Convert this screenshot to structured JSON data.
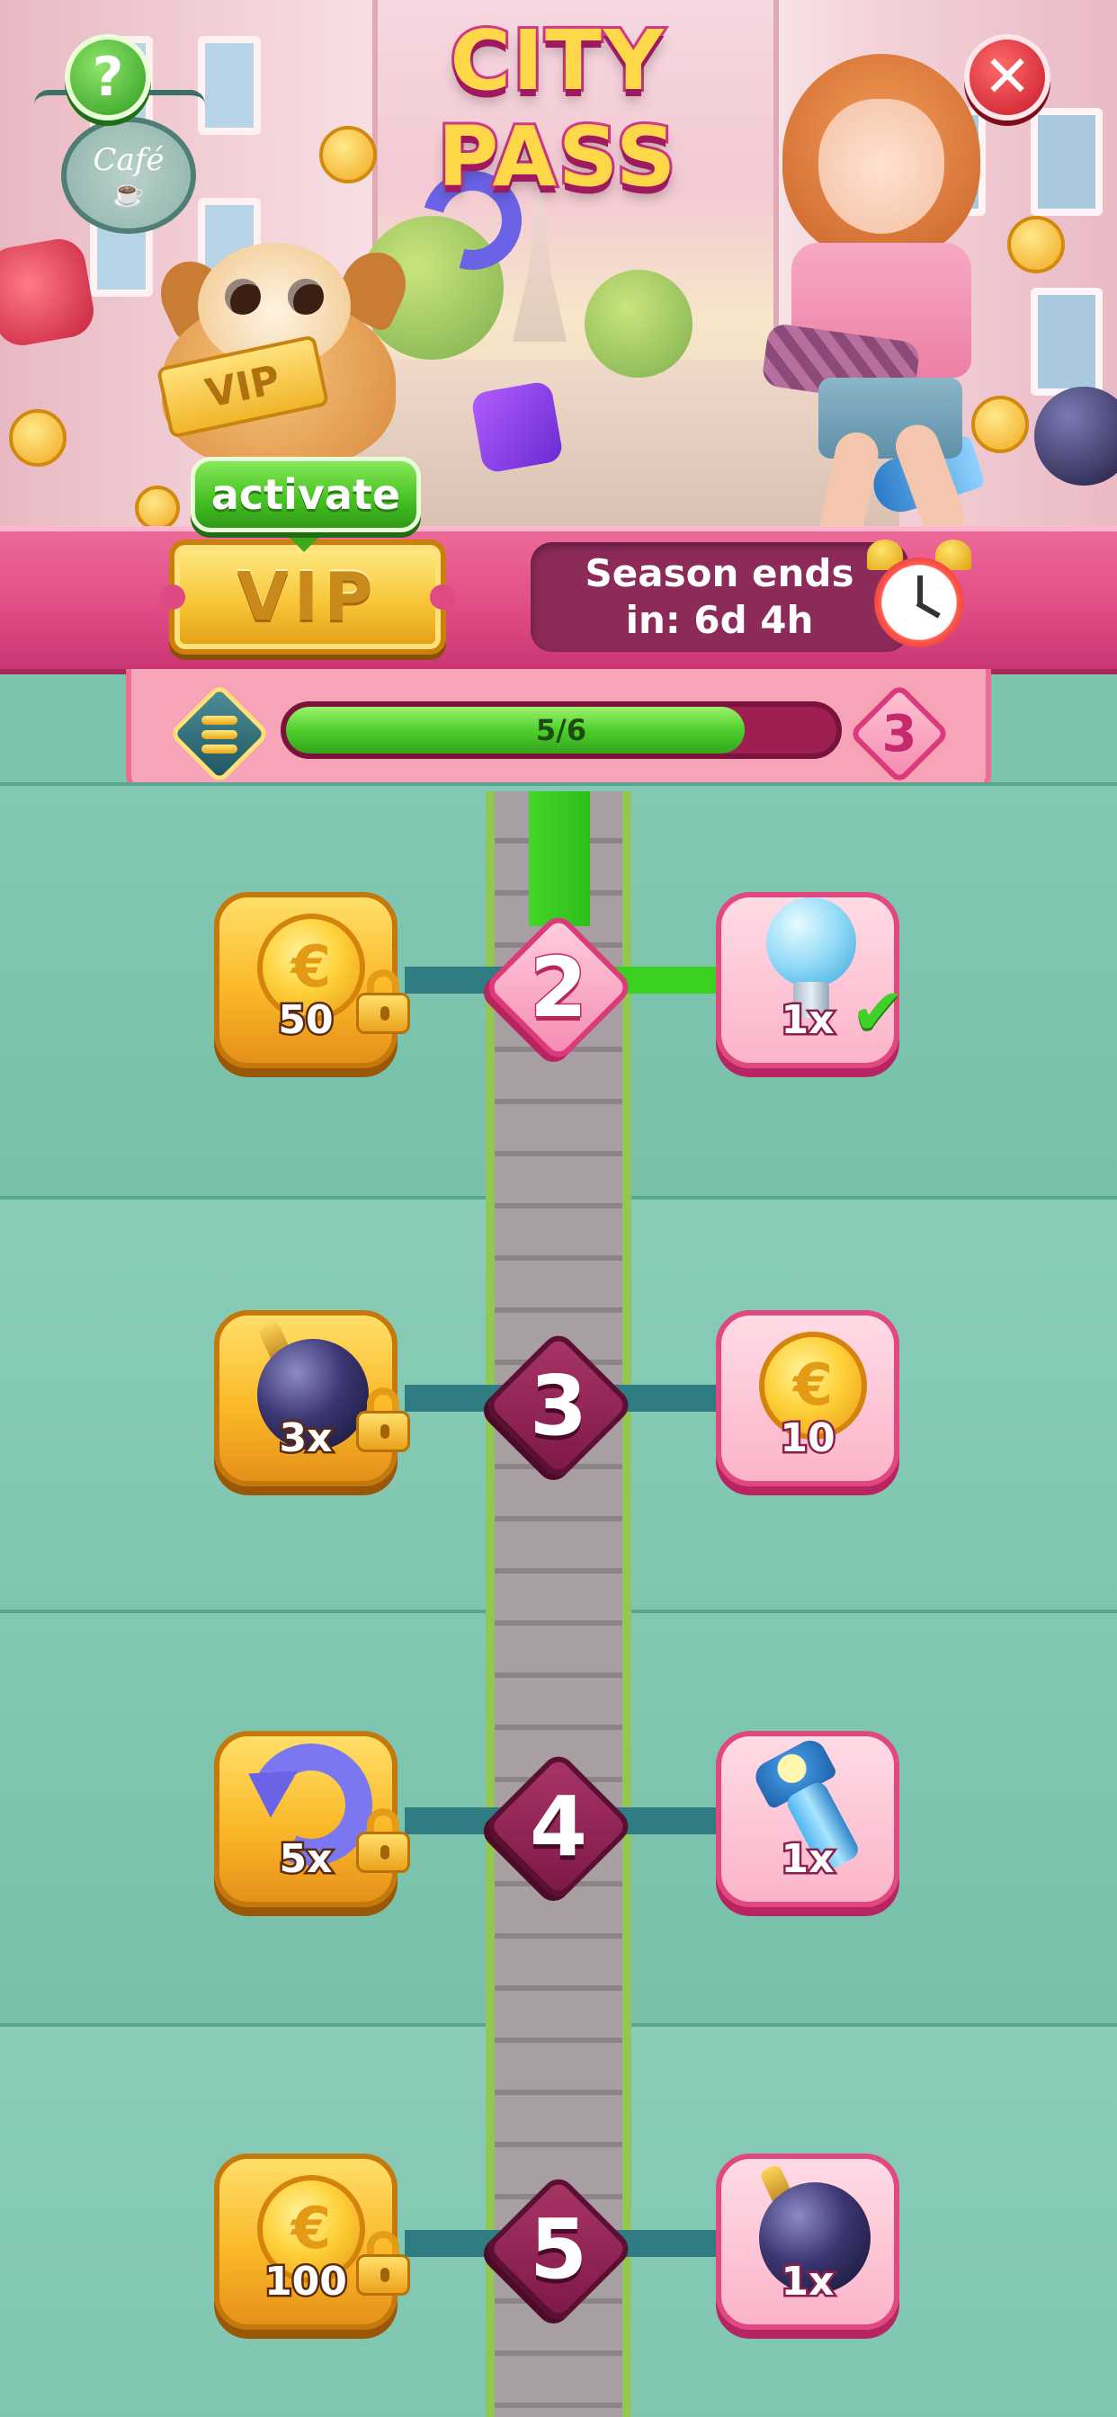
{
  "header": {
    "title": "CITY PASS",
    "help_label": "?",
    "close_label": "✕",
    "cafe_sign": "Café",
    "vip_ticket_art": "VIP"
  },
  "vip": {
    "activate_label": "activate",
    "badge_label": "VIP"
  },
  "season": {
    "line1": "Season ends",
    "line2": "in: 6d 4h"
  },
  "progress": {
    "text": "5/6",
    "fraction": 0.8333,
    "next_level": "3"
  },
  "tiers": [
    {
      "level": "2",
      "state": "current",
      "vip_reward": {
        "item": "coin-icon",
        "qty": "50",
        "locked": true
      },
      "free_reward": {
        "item": "lightbulb-icon",
        "qty": "1x",
        "claimed": true
      }
    },
    {
      "level": "3",
      "state": "locked",
      "vip_reward": {
        "item": "bomb-icon",
        "qty": "3x",
        "locked": true
      },
      "free_reward": {
        "item": "coin-icon",
        "qty": "10",
        "claimed": false
      }
    },
    {
      "level": "4",
      "state": "locked",
      "vip_reward": {
        "item": "undo-arrow-icon",
        "qty": "5x",
        "locked": true
      },
      "free_reward": {
        "item": "flashlight-icon",
        "qty": "1x",
        "claimed": false
      }
    },
    {
      "level": "5",
      "state": "locked",
      "vip_reward": {
        "item": "coin-icon",
        "qty": "100",
        "locked": true
      },
      "free_reward": {
        "item": "bomb-icon",
        "qty": "1x",
        "claimed": false
      }
    }
  ],
  "colors": {
    "accent_pink": "#e04a84",
    "progress_green": "#4fcf2d",
    "background_teal": "#7cc4ad",
    "vip_gold": "#fbb929"
  }
}
